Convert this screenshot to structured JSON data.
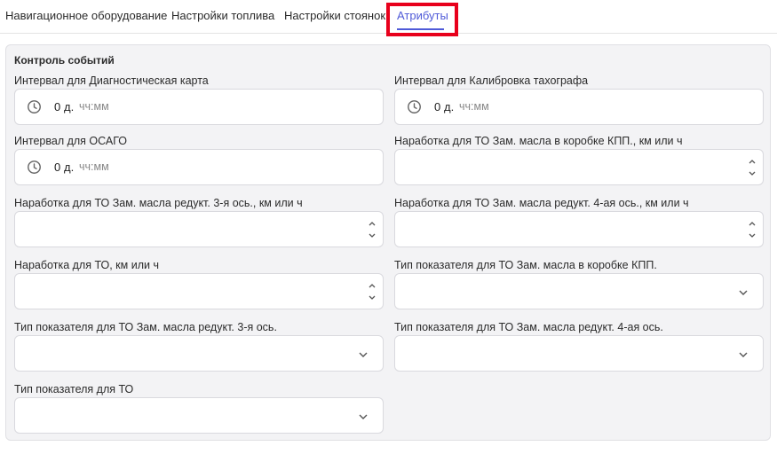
{
  "tabs": [
    {
      "label": "Навигационное оборудование"
    },
    {
      "label": "Настройки топлива"
    },
    {
      "label": "Настройки стоянок"
    },
    {
      "label": "Атрибуты"
    }
  ],
  "active_tab": "Атрибуты",
  "accent_color": "#4f5ad8",
  "highlight_color": "#e8001c",
  "section": {
    "title": "Контроль событий"
  },
  "fields": {
    "diag_card": {
      "label": "Интервал для Диагностическая карта",
      "days": "0",
      "days_unit": "д.",
      "hm_placeholder": "чч:мм"
    },
    "tacho": {
      "label": "Интервал для Калибровка тахографа",
      "days": "0",
      "days_unit": "д.",
      "hm_placeholder": "чч:мм"
    },
    "osago": {
      "label": "Интервал для ОСАГО",
      "days": "0",
      "days_unit": "д.",
      "hm_placeholder": "чч:мм"
    },
    "kpp_oil": {
      "label": "Наработка для ТО Зам. масла в коробке КПП., км или ч",
      "value": ""
    },
    "axle3_oil": {
      "label": "Наработка для ТО Зам. масла редукт. 3-я ось., км или ч",
      "value": ""
    },
    "axle4_oil": {
      "label": "Наработка для ТО Зам. масла редукт. 4-ая ось., км или ч",
      "value": ""
    },
    "to_run": {
      "label": "Наработка для ТО, км или ч",
      "value": ""
    },
    "kpp_type": {
      "label": "Тип показателя для ТО Зам. масла в коробке КПП.",
      "value": ""
    },
    "axle3_type": {
      "label": "Тип показателя для ТО Зам. масла редукт. 3-я ось.",
      "value": ""
    },
    "axle4_type": {
      "label": "Тип показателя для ТО Зам. масла редукт. 4-ая ось.",
      "value": ""
    },
    "to_type": {
      "label": "Тип показателя для ТО",
      "value": ""
    }
  },
  "icons": {
    "duration": "clock-icon",
    "number": "spinner-arrows-icon",
    "select": "chevron-down-icon"
  }
}
